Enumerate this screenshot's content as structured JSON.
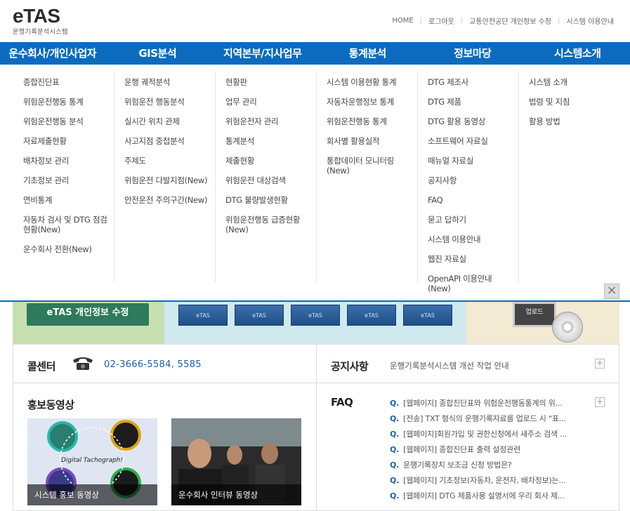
{
  "logo": {
    "main": "eTAS",
    "sub": "운행기록분석시스템"
  },
  "util_links": [
    "HOME",
    "로그아웃",
    "교통안전공단 개인정보 수정",
    "시스템 이용안내"
  ],
  "gnb": [
    "운수회사/개인사업자",
    "GIS분석",
    "지역본부/지사업무",
    "통계분석",
    "정보마당",
    "시스템소개"
  ],
  "mega_menu": [
    [
      "종합진단표",
      "위험운전행동 통계",
      "위험운전행동 분석",
      "자료제출현황",
      "배차정보 관리",
      "기초정보 관리",
      "연비통계",
      "자동차 검사 및 DTG 점검현황(New)",
      "운수회사 전환(New)"
    ],
    [
      "운행 궤적분석",
      "위험운전 행동분석",
      "실시간 위치 관제",
      "사고지점 중첩분석",
      "주제도",
      "위험운전 다발지점(New)",
      "안전운전 주의구간(New)"
    ],
    [
      "현황판",
      "업무 관리",
      "위험운전자 관리",
      "통계분석",
      "제출현황",
      "위험운전 대상검색",
      "DTG 불량발생현황",
      "위험운전행동 급증현황(New)"
    ],
    [
      "시스템 이용현황 통계",
      "자동차운행정보 통계",
      "위험운전행동 통계",
      "회사별 활용실적",
      "통합데이터 모니터링(New)"
    ],
    [
      "DTG 제조사",
      "DTG 제품",
      "DTG 활용 동영상",
      "소프트웨어 자료실",
      "매뉴얼 자료실",
      "공지사항",
      "FAQ",
      "묻고 답하기",
      "시스템 이용안내",
      "웹진 자료실",
      "OpenAPI 이용안내(New)"
    ],
    [
      "시스템 소개",
      "법령 및 지침",
      "활용 방법"
    ]
  ],
  "banner": {
    "button_label": "eTAS 개인정보 수정",
    "tiles": [
      "eTAS",
      "eTAS",
      "eTAS",
      "eTAS",
      "eTAS"
    ],
    "monitor_text": "업로드"
  },
  "call_center": {
    "title": "콜센터",
    "phone": "02-3666-5584, 5585"
  },
  "notice": {
    "title": "공지사항",
    "text": "운행기록분석시스템 개선 작업 안내",
    "plus": "+"
  },
  "promo": {
    "title": "홍보동영상",
    "videos": [
      {
        "caption": "시스템 홍보 동영상",
        "overlay": "Digital Tachograph!"
      },
      {
        "caption": "운수회사 인터뷰 동영상"
      }
    ]
  },
  "faq": {
    "title": "FAQ",
    "plus": "+",
    "q_mark": "Q.",
    "items": [
      "[웹페이지] 종합진단표와 위험운전행동통계의 위...",
      "[전송] TXT 형식의 운행기록자료를 업로드 시 \"표...",
      "[웹페이지]회원가입 및 권한신청에서 새주소 검색 ...",
      "[웹페이지] 종합진단표 출력 설정관련",
      "운행기록장치 보조금 신청 방법은?",
      "[웹페이지] 기초정보(자동차, 운전자, 배차정보)는...",
      "[웹페이지] DTG 제품사용 설명서에 우리 회사 제..."
    ]
  },
  "colors": {
    "brand_blue": "#0c6bbf",
    "green_button": "#2e7a5c",
    "link_blue": "#1e5fa8"
  }
}
